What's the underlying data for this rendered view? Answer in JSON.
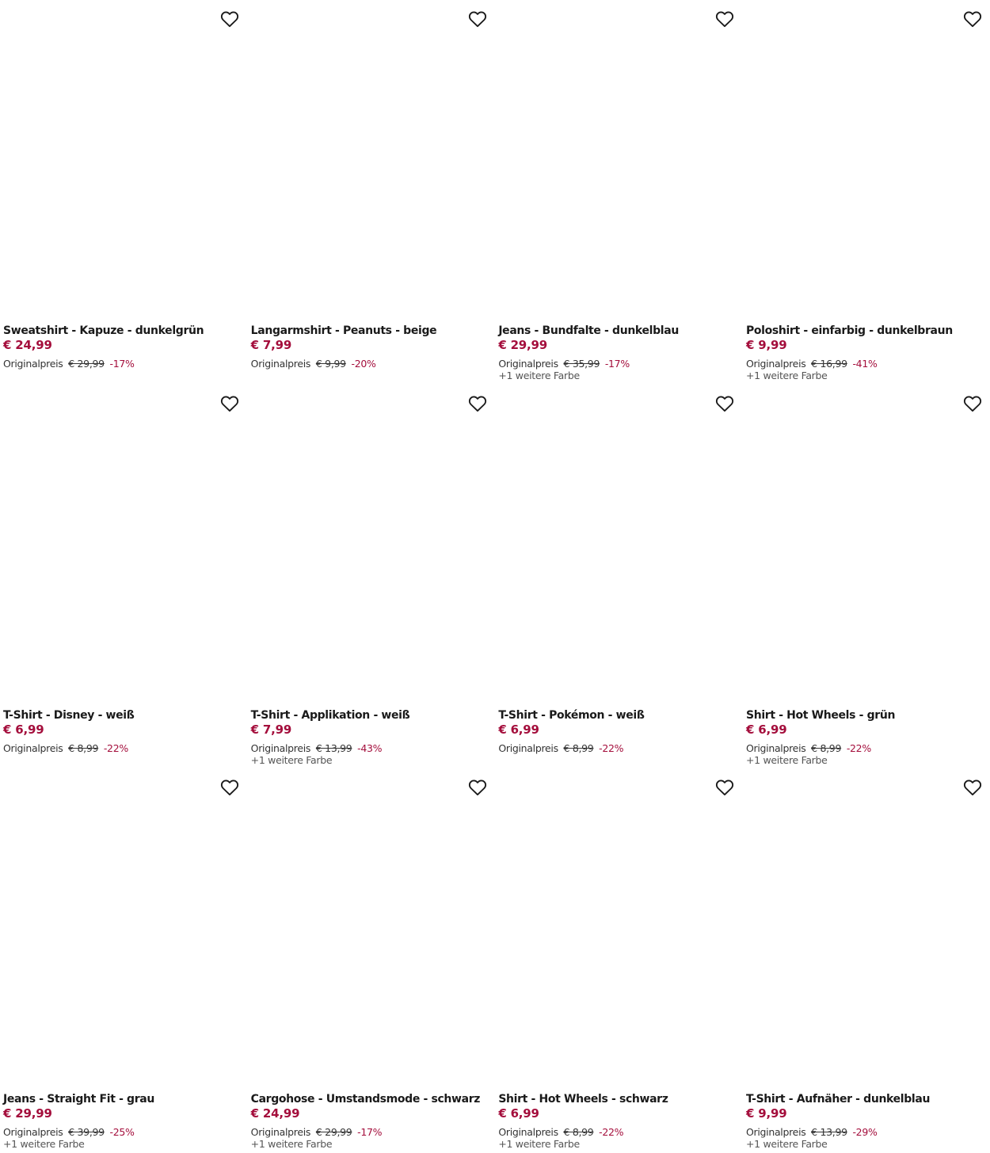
{
  "labels": {
    "original_price": "Originalpreis"
  },
  "colors": {
    "price_accent": "#a40e3c",
    "text": "#1a1a1a"
  },
  "icons": {
    "favorite": "heart-outline-icon"
  },
  "products": [
    {
      "name": "Sweatshirt - Kapuze - dunkelgrün",
      "price": "€ 24,99",
      "original_price": "€ 29,99",
      "discount": "-17%",
      "more_colors": ""
    },
    {
      "name": "Langarmshirt - Peanuts - beige",
      "price": "€ 7,99",
      "original_price": "€ 9,99",
      "discount": "-20%",
      "more_colors": ""
    },
    {
      "name": "Jeans - Bundfalte - dunkelblau",
      "price": "€ 29,99",
      "original_price": "€ 35,99",
      "discount": "-17%",
      "more_colors": "+1 weitere Farbe"
    },
    {
      "name": "Poloshirt - einfarbig - dunkelbraun",
      "price": "€ 9,99",
      "original_price": "€ 16,99",
      "discount": "-41%",
      "more_colors": "+1 weitere Farbe"
    },
    {
      "name": "T-Shirt - Disney - weiß",
      "price": "€ 6,99",
      "original_price": "€ 8,99",
      "discount": "-22%",
      "more_colors": ""
    },
    {
      "name": "T-Shirt - Applikation - weiß",
      "price": "€ 7,99",
      "original_price": "€ 13,99",
      "discount": "-43%",
      "more_colors": "+1 weitere Farbe"
    },
    {
      "name": "T-Shirt - Pokémon - weiß",
      "price": "€ 6,99",
      "original_price": "€ 8,99",
      "discount": "-22%",
      "more_colors": ""
    },
    {
      "name": "Shirt - Hot Wheels - grün",
      "price": "€ 6,99",
      "original_price": "€ 8,99",
      "discount": "-22%",
      "more_colors": "+1 weitere Farbe"
    },
    {
      "name": "Jeans - Straight Fit - grau",
      "price": "€ 29,99",
      "original_price": "€ 39,99",
      "discount": "-25%",
      "more_colors": "+1 weitere Farbe"
    },
    {
      "name": "Cargohose - Umstandsmode - schwarz",
      "price": "€ 24,99",
      "original_price": "€ 29,99",
      "discount": "-17%",
      "more_colors": "+1 weitere Farbe"
    },
    {
      "name": "Shirt - Hot Wheels - schwarz",
      "price": "€ 6,99",
      "original_price": "€ 8,99",
      "discount": "-22%",
      "more_colors": "+1 weitere Farbe"
    },
    {
      "name": "T-Shirt - Aufnäher - dunkelblau",
      "price": "€ 9,99",
      "original_price": "€ 13,99",
      "discount": "-29%",
      "more_colors": "+1 weitere Farbe"
    }
  ]
}
